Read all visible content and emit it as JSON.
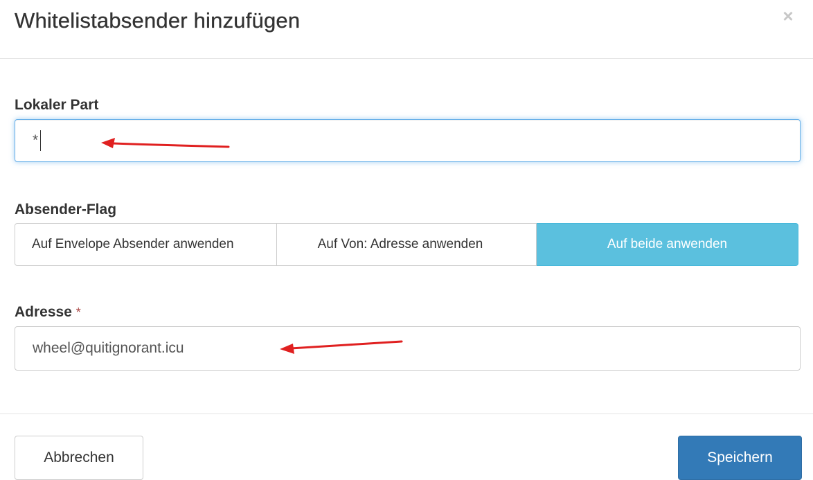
{
  "dialog": {
    "title": "Whitelistabsender hinzufügen",
    "close_glyph": "×"
  },
  "local_part": {
    "label": "Lokaler Part",
    "value": "*"
  },
  "sender_flag": {
    "label": "Absender-Flag",
    "options": [
      {
        "label": "Auf Envelope Absender anwenden",
        "selected": false
      },
      {
        "label": "Auf Von: Adresse anwenden",
        "selected": false
      },
      {
        "label": "Auf beide anwenden",
        "selected": true
      }
    ]
  },
  "address": {
    "label": "Adresse",
    "required_marker": "*",
    "value": "wheel@quitignorant.icu"
  },
  "footer": {
    "cancel_label": "Abbrechen",
    "save_label": "Speichern"
  },
  "colors": {
    "primary": "#337ab7",
    "info": "#5bc0de",
    "focus": "#66afe9",
    "annotation_arrow": "#e02020"
  }
}
